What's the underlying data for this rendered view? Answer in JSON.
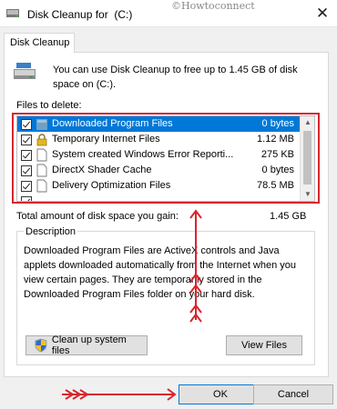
{
  "window": {
    "title": "Disk Cleanup for  (C:)",
    "watermark": "©Howtoconnect",
    "close_glyph": "✕"
  },
  "tabs": [
    {
      "label": "Disk Cleanup"
    }
  ],
  "intro_text": "You can use Disk Cleanup to free up to 1.45 GB of disk space on  (C:).",
  "files_label": "Files to delete:",
  "files": [
    {
      "name": "Downloaded Program Files",
      "size": "0 bytes",
      "checked": true,
      "icon": "folder-icon",
      "selected": true
    },
    {
      "name": "Temporary Internet Files",
      "size": "1.12 MB",
      "checked": true,
      "icon": "lock-icon",
      "selected": false
    },
    {
      "name": "System created Windows Error Reporti...",
      "size": "275 KB",
      "checked": true,
      "icon": "file-icon",
      "selected": false
    },
    {
      "name": "DirectX Shader Cache",
      "size": "0 bytes",
      "checked": true,
      "icon": "file-icon",
      "selected": false
    },
    {
      "name": "Delivery Optimization Files",
      "size": "78.5 MB",
      "checked": true,
      "icon": "file-icon",
      "selected": false
    }
  ],
  "total": {
    "label": "Total amount of disk space you gain:",
    "value": "1.45 GB"
  },
  "description": {
    "legend": "Description",
    "text": "Downloaded Program Files are ActiveX controls and Java applets downloaded automatically from the Internet when you view certain pages. They are temporarily stored in the Downloaded Program Files folder on your hard disk."
  },
  "buttons": {
    "cleanup_system": "Clean up system files",
    "view_files": "View Files",
    "ok": "OK",
    "cancel": "Cancel"
  },
  "colors": {
    "selection": "#0078d7",
    "annotation_red": "#d7262d"
  }
}
